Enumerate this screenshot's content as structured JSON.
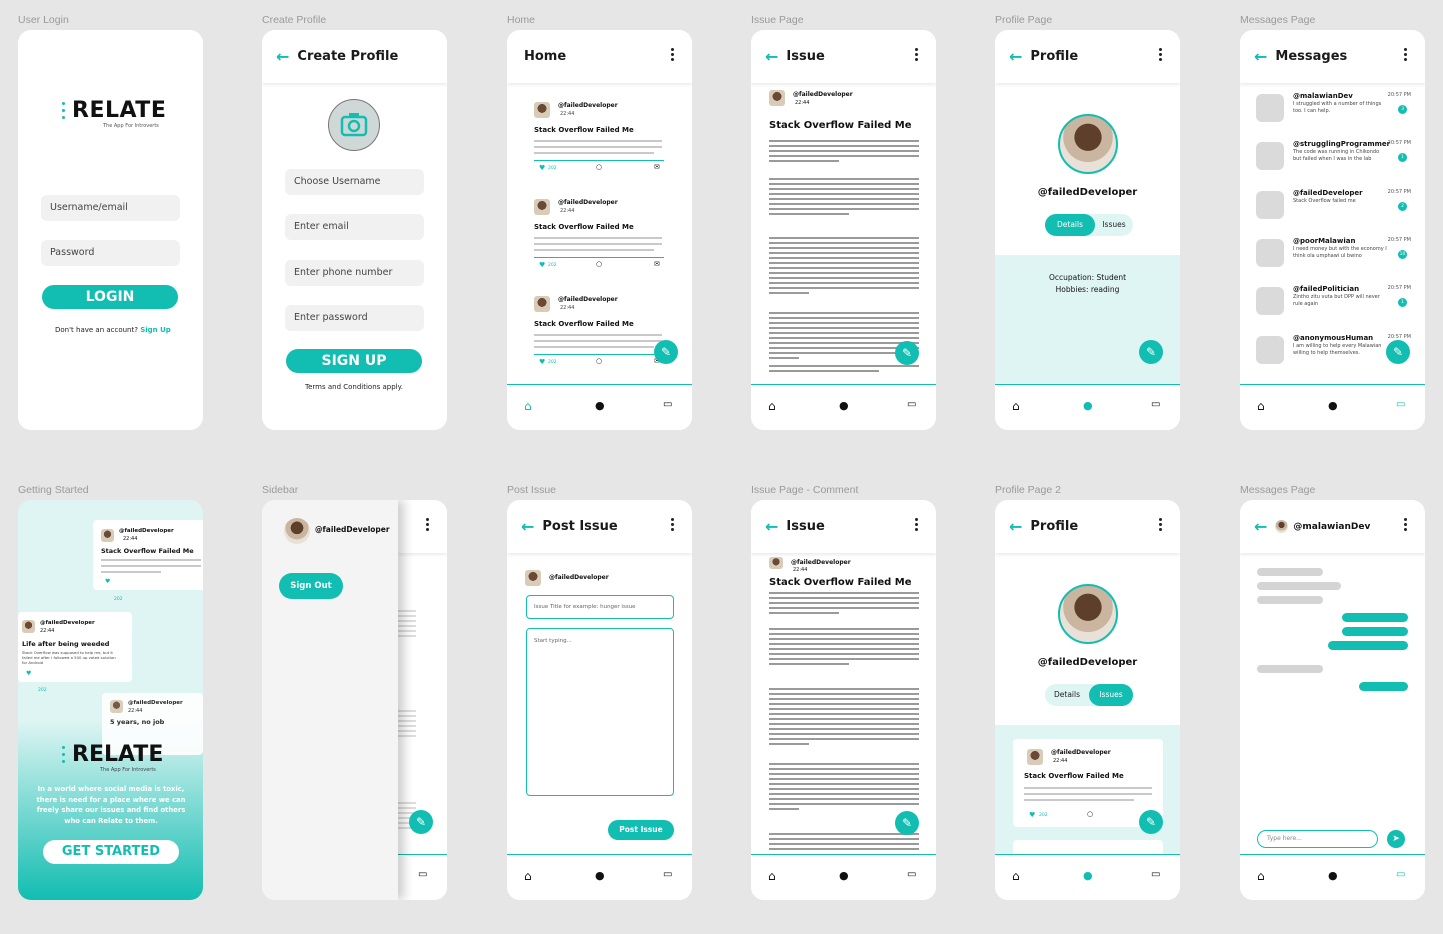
{
  "labels": {
    "user_login": "User Login",
    "create_profile": "Create Profile",
    "home": "Home",
    "issue_page": "Issue Page",
    "profile_page": "Profile Page",
    "messages_page": "Messages Page",
    "getting_started": "Getting Started",
    "sidebar": "Sidebar",
    "post_issue": "Post Issue",
    "issue_comment": "Issue Page - Comment",
    "profile_page_2": "Profile Page 2",
    "messages_page_2": "Messages Page"
  },
  "brand": {
    "name": "RELATE",
    "tagline": "The App For Introverts",
    "accent": "#12bdb1"
  },
  "login": {
    "username_ph": "Username/email",
    "password_ph": "Password",
    "login_btn": "LOGIN",
    "no_account": "Don't have an account?",
    "signup_link": "Sign Up"
  },
  "create": {
    "title": "Create Profile",
    "fields": [
      "Choose Username",
      "Enter email",
      "Enter phone number",
      "Enter password"
    ],
    "signup_btn": "SIGN UP",
    "terms": "Terms and Conditions apply."
  },
  "home": {
    "title": "Home"
  },
  "post": {
    "user": "@failedDeveloper",
    "time": "22:44",
    "title": "Stack Overflow Failed Me",
    "excerpt": "Stack Overflow was supposed to help me, but it failed me after I followed a 500 up voted solution for Android Development. I am from Malawi and things have not been easier for me this year.",
    "likes": "202"
  },
  "issue": {
    "title": "Issue",
    "heading": "Stack Overflow Failed Me"
  },
  "profile": {
    "title": "Profile",
    "handle": "@failedDeveloper",
    "tab_details": "Details",
    "tab_issues": "Issues",
    "occupation": "Occupation: Student",
    "hobbies": "Hobbies: reading"
  },
  "messages": {
    "title": "Messages",
    "items": [
      {
        "name": "@malawianDev",
        "time": "20:57 PM",
        "text": "I struggled with a number of things too. I can help.",
        "badge": "3"
      },
      {
        "name": "@strugglingProgrammer",
        "time": "20:57 PM",
        "text": "The code was running in Chikondo but failed when I was in the lab",
        "badge": "1"
      },
      {
        "name": "@failedDeveloper",
        "time": "20:57 PM",
        "text": "Stack Overflow failed me",
        "badge": "2"
      },
      {
        "name": "@poorMalawian",
        "time": "20:57 PM",
        "text": "I need money but with the economy I think ola umphawi ul bwino",
        "badge": "10"
      },
      {
        "name": "@failedPolitician",
        "time": "20:57 PM",
        "text": "Zintho zitu vuta but DPP will never rule again",
        "badge": "1"
      },
      {
        "name": "@anonymousHuman",
        "time": "20:57 PM",
        "text": "I am willing to help every Malawian willing to help themselves.",
        "badge": ""
      }
    ]
  },
  "getting_started": {
    "card1_title": "Stack Overflow Failed Me",
    "card2_title": "Life after being weeded",
    "card3_title": "5 years, no job",
    "card2_text": "Stack Overflow was supposed to help me, but it failed me after I followed a 500 up voted solution for Android",
    "intro": "In a world where social media is toxic, there is need for a place where we can freely share our issues and find others who can Relate to them.",
    "cta": "GET STARTED",
    "count": "202"
  },
  "sidebar": {
    "user": "@failedDeveloper",
    "signout": "Sign Out"
  },
  "post_issue": {
    "title": "Post Issue",
    "user": "@failedDeveloper",
    "title_ph": "Issue Title for example: hunger issue",
    "body_ph": "Start typing...",
    "btn": "Post Issue"
  },
  "chat": {
    "contact": "@malawianDev",
    "input_ph": "Type here..."
  }
}
